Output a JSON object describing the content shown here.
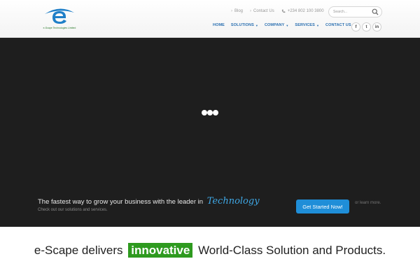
{
  "brand": {
    "logo_text": "e-Scape Technologies Limited",
    "colors": {
      "primary": "#1f8ed8",
      "nav": "#2a6fb0",
      "accent_green": "#2e9a1f",
      "hero_bg": "#1e1e1e"
    }
  },
  "top_links": [
    {
      "label": "Blog",
      "icon": "chevron-right-icon"
    },
    {
      "label": "Contact Us",
      "icon": "chevron-right-icon"
    },
    {
      "label": "+234 802 100 3800",
      "icon": "phone-icon"
    }
  ],
  "search": {
    "placeholder": "Search...",
    "icon": "search-icon"
  },
  "nav": {
    "home": "HOME",
    "solutions": "SOLUTIONS",
    "company": "COMPANY",
    "services": "SERVICES",
    "contact": "CONTACT US"
  },
  "social": {
    "facebook": "f",
    "twitter": "t",
    "linkedin": "in"
  },
  "hero": {
    "tagline": "The fastest way to grow your business with the leader in",
    "tagline_highlight": "Technology",
    "subline": "Check out our solutions and services.",
    "cta_label": "Get Started Now!",
    "learn_more": "or learn more."
  },
  "headline": {
    "before": "e-Scape delivers",
    "highlight": "innovative",
    "after": "World-Class Solution and Products."
  }
}
